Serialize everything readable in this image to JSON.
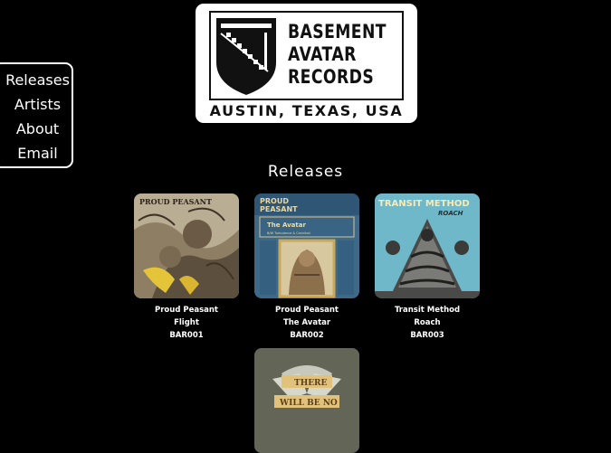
{
  "logo": {
    "lines": [
      "BASEMENT",
      "AVATAR",
      "RECORDS"
    ],
    "location": "AUSTIN, TEXAS, USA"
  },
  "nav": {
    "items": [
      {
        "label": "Releases"
      },
      {
        "label": "Artists"
      },
      {
        "label": "About"
      },
      {
        "label": "Email"
      }
    ]
  },
  "section_title": "Releases",
  "releases": [
    {
      "artist": "Proud Peasant",
      "title": "Flight",
      "catalog": "BAR001"
    },
    {
      "artist": "Proud Peasant",
      "title": "The Avatar",
      "catalog": "BAR002"
    },
    {
      "artist": "Transit Method",
      "title": "Roach",
      "catalog": "BAR003"
    }
  ],
  "cover_text": {
    "bar001_band": "PROUD PEASANT",
    "bar002_band_line1": "PROUD",
    "bar002_band_line2": "PEASANT",
    "bar002_title": "The Avatar",
    "bar002_sub": "B/W Turbulence & Cannibal",
    "bar003_band": "TRANSIT METHOD",
    "bar003_title": "ROACH",
    "bar004_line1": "THERE",
    "bar004_line2": "WILL BE NO"
  }
}
